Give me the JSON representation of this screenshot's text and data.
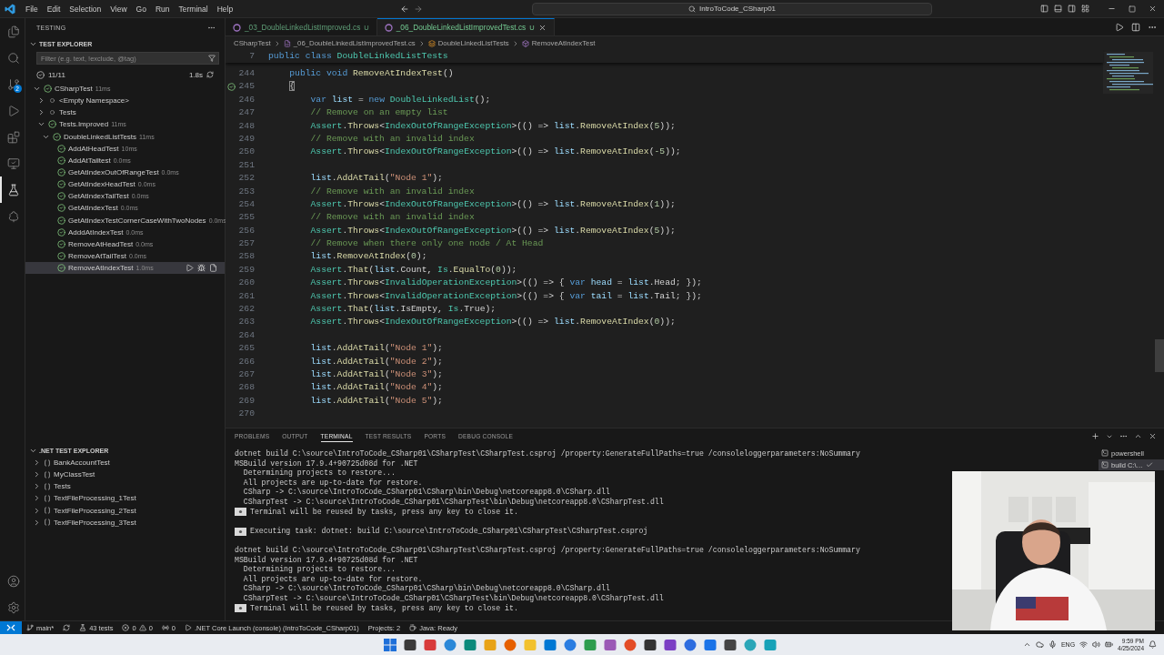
{
  "title_bar": {
    "menu": [
      "File",
      "Edit",
      "Selection",
      "View",
      "Go",
      "Run",
      "Terminal",
      "Help"
    ],
    "search": "IntroToCode_CSharp01"
  },
  "activity_bar": {
    "items": [
      {
        "selected": false
      },
      {
        "selected": false
      },
      {
        "selected": false,
        "badge": "2"
      },
      {
        "selected": false
      },
      {
        "selected": false
      },
      {
        "selected": false
      },
      {
        "selected": true
      },
      {
        "selected": false
      }
    ]
  },
  "sidebar": {
    "title": "TESTING",
    "test_explorer": {
      "title": "TEST EXPLORER",
      "expanded": true,
      "filter": {
        "placeholder": "Filter (e.g. text, !exclude, @tag)"
      },
      "summary": {
        "passed": "11/11",
        "duration": "1.8s"
      },
      "tree": [
        {
          "label": "CSharpTest",
          "duration": "11ms",
          "passed": true,
          "expanded": true,
          "selected": false,
          "children": [
            {
              "label": "<Empty Namespace>",
              "passed": false,
              "expanded": false,
              "selected": false
            },
            {
              "label": "Tests",
              "passed": false,
              "expanded": false,
              "selected": false
            },
            {
              "label": "Tests.Improved",
              "duration": "11ms",
              "passed": true,
              "expanded": true,
              "selected": false,
              "children": [
                {
                  "label": "DoubleLinkedListTests",
                  "duration": "11ms",
                  "passed": true,
                  "expanded": true,
                  "selected": false,
                  "children": [
                    {
                      "label": "AddAtHeadTest",
                      "duration": "10ms",
                      "passed": true,
                      "selected": false
                    },
                    {
                      "label": "AddAtTailtest",
                      "duration": "0.0ms",
                      "passed": true,
                      "selected": false
                    },
                    {
                      "label": "GetAtIndexOutOfRangeTest",
                      "duration": "0.0ms",
                      "passed": true,
                      "selected": false
                    },
                    {
                      "label": "GetAtIndexHeadTest",
                      "duration": "0.0ms",
                      "passed": true,
                      "selected": false
                    },
                    {
                      "label": "GetAtIndexTailTest",
                      "duration": "0.0ms",
                      "passed": true,
                      "selected": false
                    },
                    {
                      "label": "GetAtIndexTest",
                      "duration": "0.0ms",
                      "passed": true,
                      "selected": false
                    },
                    {
                      "label": "GetAtIndexTestCornerCaseWithTwoNodes",
                      "duration": "0.0ms",
                      "passed": true,
                      "selected": false
                    },
                    {
                      "label": "AdddAtIndexTest",
                      "duration": "0.0ms",
                      "passed": true,
                      "selected": false
                    },
                    {
                      "label": "RemoveAtHeadTest",
                      "duration": "0.0ms",
                      "passed": true,
                      "selected": false
                    },
                    {
                      "label": "RemoveAtTailTest",
                      "duration": "0.0ms",
                      "passed": true,
                      "selected": false
                    },
                    {
                      "label": "RemoveAtIndexTest",
                      "duration": "1.0ms",
                      "passed": true,
                      "selected": true
                    }
                  ]
                }
              ]
            }
          ]
        }
      ]
    },
    "dotnet_test_explorer": {
      "title": ".NET TEST EXPLORER",
      "expanded": true,
      "items": [
        {
          "label": "BankAccountTest",
          "expanded": false
        },
        {
          "label": "MyClassTest",
          "expanded": false
        },
        {
          "label": "Tests",
          "expanded": false
        },
        {
          "label": "TextFileProcessing_1Test",
          "expanded": false
        },
        {
          "label": "TextFileProcessing_2Test",
          "expanded": false
        },
        {
          "label": "TextFileProcessing_3Test",
          "expanded": false
        }
      ]
    }
  },
  "editor": {
    "tabs": [
      {
        "label": "_03_DoubleLinkedListImproved.cs",
        "badge": "U",
        "selected": false
      },
      {
        "label": "_06_DoubleLinkedListImprovedTest.cs",
        "badge": "U",
        "selected": true
      }
    ],
    "breadcrumbs": [
      {
        "kind": "folder",
        "text": "CSharpTest"
      },
      {
        "kind": "file",
        "text": "_06_DoubleLinkedListImprovedTest.cs"
      },
      {
        "kind": "class",
        "text": "DoubleLinkedListTests"
      },
      {
        "kind": "method",
        "text": "RemoveAtIndexTest"
      }
    ],
    "sticky_line": {
      "number": "7",
      "tokens": [
        {
          "kind": "kw",
          "text": "public class "
        },
        {
          "kind": "type",
          "text": "DoubleLinkedListTests"
        }
      ]
    },
    "lines": [
      {
        "number": "244",
        "tokens": [
          {
            "kind": "kw",
            "text": "    public void "
          },
          {
            "kind": "fn",
            "text": "RemoveAtIndexTest"
          },
          {
            "kind": "plain",
            "text": "()"
          }
        ]
      },
      {
        "number": "245",
        "test_passed": true,
        "tokens": [
          {
            "kind": "bracket",
            "text": "    {"
          }
        ]
      },
      {
        "number": "246",
        "tokens": [
          {
            "kind": "kw",
            "text": "        var "
          },
          {
            "kind": "var",
            "text": "list"
          },
          {
            "kind": "plain",
            "text": " = "
          },
          {
            "kind": "kw",
            "text": "new "
          },
          {
            "kind": "type",
            "text": "DoubleLinkedList"
          },
          {
            "kind": "plain",
            "text": "();"
          }
        ]
      },
      {
        "number": "247",
        "tokens": [
          {
            "kind": "cm",
            "text": "        // Remove on an empty list"
          }
        ]
      },
      {
        "number": "248",
        "tokens": [
          {
            "kind": "type",
            "text": "        Assert"
          },
          {
            "kind": "plain",
            "text": "."
          },
          {
            "kind": "fn",
            "text": "Throws"
          },
          {
            "kind": "plain",
            "text": "<"
          },
          {
            "kind": "type",
            "text": "IndexOutOfRangeException"
          },
          {
            "kind": "plain",
            "text": ">(() => "
          },
          {
            "kind": "var",
            "text": "list"
          },
          {
            "kind": "plain",
            "text": "."
          },
          {
            "kind": "fn",
            "text": "RemoveAtIndex"
          },
          {
            "kind": "plain",
            "text": "("
          },
          {
            "kind": "num",
            "text": "5"
          },
          {
            "kind": "plain",
            "text": "));"
          }
        ]
      },
      {
        "number": "249",
        "tokens": [
          {
            "kind": "cm",
            "text": "        // Remove with an invalid index"
          }
        ]
      },
      {
        "number": "250",
        "tokens": [
          {
            "kind": "type",
            "text": "        Assert"
          },
          {
            "kind": "plain",
            "text": "."
          },
          {
            "kind": "fn",
            "text": "Throws"
          },
          {
            "kind": "plain",
            "text": "<"
          },
          {
            "kind": "type",
            "text": "IndexOutOfRangeException"
          },
          {
            "kind": "plain",
            "text": ">(() => "
          },
          {
            "kind": "var",
            "text": "list"
          },
          {
            "kind": "plain",
            "text": "."
          },
          {
            "kind": "fn",
            "text": "RemoveAtIndex"
          },
          {
            "kind": "plain",
            "text": "("
          },
          {
            "kind": "num",
            "text": "-5"
          },
          {
            "kind": "plain",
            "text": "));"
          }
        ]
      },
      {
        "number": "251"
      },
      {
        "number": "252",
        "tokens": [
          {
            "kind": "var",
            "text": "        list"
          },
          {
            "kind": "plain",
            "text": "."
          },
          {
            "kind": "fn",
            "text": "AddAtTail"
          },
          {
            "kind": "plain",
            "text": "("
          },
          {
            "kind": "str",
            "text": "\"Node 1\""
          },
          {
            "kind": "plain",
            "text": ");"
          }
        ]
      },
      {
        "number": "253",
        "tokens": [
          {
            "kind": "cm",
            "text": "        // Remove with an invalid index"
          }
        ]
      },
      {
        "number": "254",
        "tokens": [
          {
            "kind": "type",
            "text": "        Assert"
          },
          {
            "kind": "plain",
            "text": "."
          },
          {
            "kind": "fn",
            "text": "Throws"
          },
          {
            "kind": "plain",
            "text": "<"
          },
          {
            "kind": "type",
            "text": "IndexOutOfRangeException"
          },
          {
            "kind": "plain",
            "text": ">(() => "
          },
          {
            "kind": "var",
            "text": "list"
          },
          {
            "kind": "plain",
            "text": "."
          },
          {
            "kind": "fn",
            "text": "RemoveAtIndex"
          },
          {
            "kind": "plain",
            "text": "("
          },
          {
            "kind": "num",
            "text": "1"
          },
          {
            "kind": "plain",
            "text": "));"
          }
        ]
      },
      {
        "number": "255",
        "tokens": [
          {
            "kind": "cm",
            "text": "        // Remove with an invalid index"
          }
        ]
      },
      {
        "number": "256",
        "tokens": [
          {
            "kind": "type",
            "text": "        Assert"
          },
          {
            "kind": "plain",
            "text": "."
          },
          {
            "kind": "fn",
            "text": "Throws"
          },
          {
            "kind": "plain",
            "text": "<"
          },
          {
            "kind": "type",
            "text": "IndexOutOfRangeException"
          },
          {
            "kind": "plain",
            "text": ">(() => "
          },
          {
            "kind": "var",
            "text": "list"
          },
          {
            "kind": "plain",
            "text": "."
          },
          {
            "kind": "fn",
            "text": "RemoveAtIndex"
          },
          {
            "kind": "plain",
            "text": "("
          },
          {
            "kind": "num",
            "text": "5"
          },
          {
            "kind": "plain",
            "text": "));"
          }
        ]
      },
      {
        "number": "257",
        "tokens": [
          {
            "kind": "cm",
            "text": "        // Remove when there only one node / At Head"
          }
        ]
      },
      {
        "number": "258",
        "tokens": [
          {
            "kind": "var",
            "text": "        list"
          },
          {
            "kind": "plain",
            "text": "."
          },
          {
            "kind": "fn",
            "text": "RemoveAtIndex"
          },
          {
            "kind": "plain",
            "text": "("
          },
          {
            "kind": "num",
            "text": "0"
          },
          {
            "kind": "plain",
            "text": ");"
          }
        ]
      },
      {
        "number": "259",
        "tokens": [
          {
            "kind": "type",
            "text": "        Assert"
          },
          {
            "kind": "plain",
            "text": "."
          },
          {
            "kind": "fn",
            "text": "That"
          },
          {
            "kind": "plain",
            "text": "("
          },
          {
            "kind": "var",
            "text": "list"
          },
          {
            "kind": "plain",
            "text": ".Count, "
          },
          {
            "kind": "type",
            "text": "Is"
          },
          {
            "kind": "plain",
            "text": "."
          },
          {
            "kind": "fn",
            "text": "EqualTo"
          },
          {
            "kind": "plain",
            "text": "("
          },
          {
            "kind": "num",
            "text": "0"
          },
          {
            "kind": "plain",
            "text": "));"
          }
        ]
      },
      {
        "number": "260",
        "tokens": [
          {
            "kind": "type",
            "text": "        Assert"
          },
          {
            "kind": "plain",
            "text": "."
          },
          {
            "kind": "fn",
            "text": "Throws"
          },
          {
            "kind": "plain",
            "text": "<"
          },
          {
            "kind": "type",
            "text": "InvalidOperationException"
          },
          {
            "kind": "plain",
            "text": ">(() => { "
          },
          {
            "kind": "kw",
            "text": "var "
          },
          {
            "kind": "var",
            "text": "head"
          },
          {
            "kind": "plain",
            "text": " = "
          },
          {
            "kind": "var",
            "text": "list"
          },
          {
            "kind": "plain",
            "text": ".Head; });"
          }
        ]
      },
      {
        "number": "261",
        "tokens": [
          {
            "kind": "type",
            "text": "        Assert"
          },
          {
            "kind": "plain",
            "text": "."
          },
          {
            "kind": "fn",
            "text": "Throws"
          },
          {
            "kind": "plain",
            "text": "<"
          },
          {
            "kind": "type",
            "text": "InvalidOperationException"
          },
          {
            "kind": "plain",
            "text": ">(() => { "
          },
          {
            "kind": "kw",
            "text": "var "
          },
          {
            "kind": "var",
            "text": "tail"
          },
          {
            "kind": "plain",
            "text": " = "
          },
          {
            "kind": "var",
            "text": "list"
          },
          {
            "kind": "plain",
            "text": ".Tail; });"
          }
        ]
      },
      {
        "number": "262",
        "tokens": [
          {
            "kind": "type",
            "text": "        Assert"
          },
          {
            "kind": "plain",
            "text": "."
          },
          {
            "kind": "fn",
            "text": "That"
          },
          {
            "kind": "plain",
            "text": "("
          },
          {
            "kind": "var",
            "text": "list"
          },
          {
            "kind": "plain",
            "text": ".IsEmpty, "
          },
          {
            "kind": "type",
            "text": "Is"
          },
          {
            "kind": "plain",
            "text": ".True);"
          }
        ]
      },
      {
        "number": "263",
        "tokens": [
          {
            "kind": "type",
            "text": "        Assert"
          },
          {
            "kind": "plain",
            "text": "."
          },
          {
            "kind": "fn",
            "text": "Throws"
          },
          {
            "kind": "plain",
            "text": "<"
          },
          {
            "kind": "type",
            "text": "IndexOutOfRangeException"
          },
          {
            "kind": "plain",
            "text": ">(() => "
          },
          {
            "kind": "var",
            "text": "list"
          },
          {
            "kind": "plain",
            "text": "."
          },
          {
            "kind": "fn",
            "text": "RemoveAtIndex"
          },
          {
            "kind": "plain",
            "text": "("
          },
          {
            "kind": "num",
            "text": "0"
          },
          {
            "kind": "plain",
            "text": "));"
          }
        ]
      },
      {
        "number": "264"
      },
      {
        "number": "265",
        "tokens": [
          {
            "kind": "var",
            "text": "        list"
          },
          {
            "kind": "plain",
            "text": "."
          },
          {
            "kind": "fn",
            "text": "AddAtTail"
          },
          {
            "kind": "plain",
            "text": "("
          },
          {
            "kind": "str",
            "text": "\"Node 1\""
          },
          {
            "kind": "plain",
            "text": ");"
          }
        ]
      },
      {
        "number": "266",
        "tokens": [
          {
            "kind": "var",
            "text": "        list"
          },
          {
            "kind": "plain",
            "text": "."
          },
          {
            "kind": "fn",
            "text": "AddAtTail"
          },
          {
            "kind": "plain",
            "text": "("
          },
          {
            "kind": "str",
            "text": "\"Node 2\""
          },
          {
            "kind": "plain",
            "text": ");"
          }
        ]
      },
      {
        "number": "267",
        "tokens": [
          {
            "kind": "var",
            "text": "        list"
          },
          {
            "kind": "plain",
            "text": "."
          },
          {
            "kind": "fn",
            "text": "AddAtTail"
          },
          {
            "kind": "plain",
            "text": "("
          },
          {
            "kind": "str",
            "text": "\"Node 3\""
          },
          {
            "kind": "plain",
            "text": ");"
          }
        ]
      },
      {
        "number": "268",
        "tokens": [
          {
            "kind": "var",
            "text": "        list"
          },
          {
            "kind": "plain",
            "text": "."
          },
          {
            "kind": "fn",
            "text": "AddAtTail"
          },
          {
            "kind": "plain",
            "text": "("
          },
          {
            "kind": "str",
            "text": "\"Node 4\""
          },
          {
            "kind": "plain",
            "text": ");"
          }
        ]
      },
      {
        "number": "269",
        "tokens": [
          {
            "kind": "var",
            "text": "        list"
          },
          {
            "kind": "plain",
            "text": "."
          },
          {
            "kind": "fn",
            "text": "AddAtTail"
          },
          {
            "kind": "plain",
            "text": "("
          },
          {
            "kind": "str",
            "text": "\"Node 5\""
          },
          {
            "kind": "plain",
            "text": ");"
          }
        ]
      },
      {
        "number": "270"
      }
    ]
  },
  "panel": {
    "tabs": [
      {
        "label": "PROBLEMS",
        "selected": false
      },
      {
        "label": "OUTPUT",
        "selected": false
      },
      {
        "label": "TERMINAL",
        "selected": true
      },
      {
        "label": "TEST RESULTS",
        "selected": false
      },
      {
        "label": "PORTS",
        "selected": false
      },
      {
        "label": "DEBUG CONSOLE",
        "selected": false
      }
    ],
    "terminal": {
      "lines": [
        {
          "kind": "text",
          "text": "dotnet build C:\\source\\IntroToCode_CSharp01\\CSharpTest\\CSharpTest.csproj /property:GenerateFullPaths=true /consoleloggerparameters:NoSummary"
        },
        {
          "kind": "text",
          "text": "MSBuild version 17.9.4+90725d08d for .NET"
        },
        {
          "kind": "text",
          "text": "  Determining projects to restore..."
        },
        {
          "kind": "text",
          "text": "  All projects are up-to-date for restore."
        },
        {
          "kind": "text",
          "text": "  CSharp -> C:\\source\\IntroToCode_CSharp01\\CSharp\\bin\\Debug\\netcoreapp8.0\\CSharp.dll"
        },
        {
          "kind": "text",
          "text": "  CSharpTest -> C:\\source\\IntroToCode_CSharp01\\CSharpTest\\bin\\Debug\\netcoreapp8.0\\CSharpTest.dll"
        },
        {
          "kind": "task",
          "text": "Terminal will be reused by tasks, press any key to close it."
        },
        {
          "kind": "blank"
        },
        {
          "kind": "task",
          "text": "Executing task: dotnet: build C:\\source\\IntroToCode_CSharp01\\CSharpTest\\CSharpTest.csproj"
        },
        {
          "kind": "blank"
        },
        {
          "kind": "text",
          "text": "dotnet build C:\\source\\IntroToCode_CSharp01\\CSharpTest\\CSharpTest.csproj /property:GenerateFullPaths=true /consoleloggerparameters:NoSummary"
        },
        {
          "kind": "text",
          "text": "MSBuild version 17.9.4+90725d08d for .NET"
        },
        {
          "kind": "text",
          "text": "  Determining projects to restore..."
        },
        {
          "kind": "text",
          "text": "  All projects are up-to-date for restore."
        },
        {
          "kind": "text",
          "text": "  CSharp -> C:\\source\\IntroToCode_CSharp01\\CSharp\\bin\\Debug\\netcoreapp8.0\\CSharp.dll"
        },
        {
          "kind": "text",
          "text": "  CSharpTest -> C:\\source\\IntroToCode_CSharp01\\CSharpTest\\bin\\Debug\\netcoreapp8.0\\CSharpTest.dll"
        },
        {
          "kind": "task",
          "text": "Terminal will be reused by tasks, press any key to close it."
        }
      ]
    },
    "terminal_list": [
      {
        "label": "powershell",
        "selected": false,
        "completed": false
      },
      {
        "label": "build C:\\…",
        "selected": true,
        "completed": true
      }
    ]
  },
  "status_bar": {
    "items": [
      {
        "kind": "remote"
      },
      {
        "kind": "branch",
        "text": "main*"
      },
      {
        "kind": "sync"
      },
      {
        "kind": "tests",
        "text": "43 tests"
      },
      {
        "kind": "problems",
        "errors": "0",
        "warnings": "0"
      },
      {
        "kind": "ports",
        "text": "0"
      },
      {
        "kind": "launch",
        "text": ".NET Core Launch (console) (IntroToCode_CSharp01)"
      },
      {
        "kind": "text",
        "text": "Projects: 2"
      },
      {
        "kind": "java",
        "text": "Java: Ready"
      }
    ]
  },
  "taskbar": {
    "tray": {
      "language": "ENG",
      "time": "9:59 PM",
      "date": "4/25/2024"
    }
  }
}
